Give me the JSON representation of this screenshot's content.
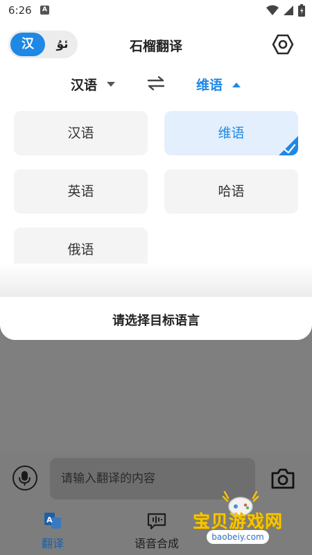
{
  "status_bar": {
    "time": "6:26",
    "notification_letter": "A"
  },
  "header": {
    "ui_lang_active": "汉",
    "ui_lang_inactive": "ئۇ",
    "title": "石榴翻译"
  },
  "lang_bar": {
    "source_lang": "汉语",
    "target_lang": "维语"
  },
  "language_options": [
    {
      "label": "汉语",
      "selected": false
    },
    {
      "label": "维语",
      "selected": true
    },
    {
      "label": "英语",
      "selected": false
    },
    {
      "label": "哈语",
      "selected": false
    },
    {
      "label": "俄语",
      "selected": false
    }
  ],
  "sheet_footer": {
    "text": "请选择目标语言"
  },
  "input": {
    "placeholder": "请输入翻译的内容",
    "value": ""
  },
  "bottom_nav": {
    "items": [
      {
        "label": "翻译",
        "active": true
      },
      {
        "label": "语音合成",
        "active": false
      }
    ]
  },
  "watermark": {
    "text": "宝贝游戏网",
    "url": "baobeiy.com"
  },
  "colors": {
    "accent": "#1e88e5",
    "selected_bg": "#e4effd",
    "option_bg": "#f4f4f4",
    "overlay": "#7f7f7f"
  }
}
